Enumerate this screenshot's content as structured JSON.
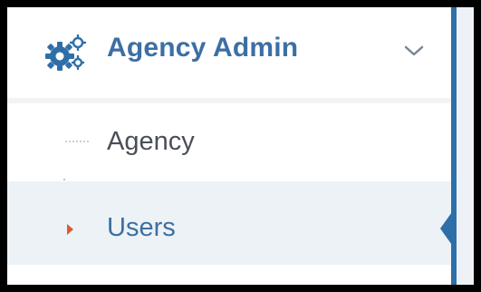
{
  "menu": {
    "title": "Agency Admin",
    "icon": "gears-icon",
    "expand_icon": "chevron-down-icon",
    "items": [
      {
        "label": "Agency",
        "active": false
      },
      {
        "label": "Users",
        "active": true
      }
    ]
  },
  "colors": {
    "title": "#3c6fa4",
    "active_item_bg": "#edf2f7",
    "active_marker": "#2f6fa8",
    "active_caret": "#d95c32",
    "inactive_text": "#4a4f57"
  }
}
